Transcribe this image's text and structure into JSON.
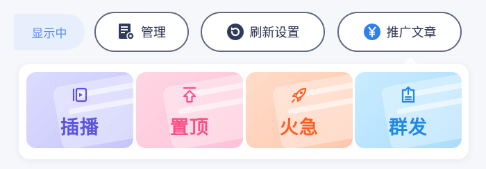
{
  "status": {
    "label": "显示中"
  },
  "actions": {
    "manage": {
      "label": "管理"
    },
    "refresh": {
      "label": "刷新设置"
    },
    "promote": {
      "label": "推广文章"
    }
  },
  "popup": {
    "tiles": [
      {
        "label": "插播",
        "icon": "insert-icon",
        "color": "#5b54e0"
      },
      {
        "label": "置顶",
        "icon": "pin-top-icon",
        "color": "#ff4f86"
      },
      {
        "label": "火急",
        "icon": "rocket-icon",
        "color": "#ff5f24"
      },
      {
        "label": "群发",
        "icon": "broadcast-icon",
        "color": "#1e88e5"
      }
    ]
  },
  "colors": {
    "status_bg": "#e7effd",
    "status_text": "#5b8ef0",
    "button_border": "#5d6883",
    "icon_navy": "#2f3b5c",
    "yen_blue": "#2f80ed"
  }
}
